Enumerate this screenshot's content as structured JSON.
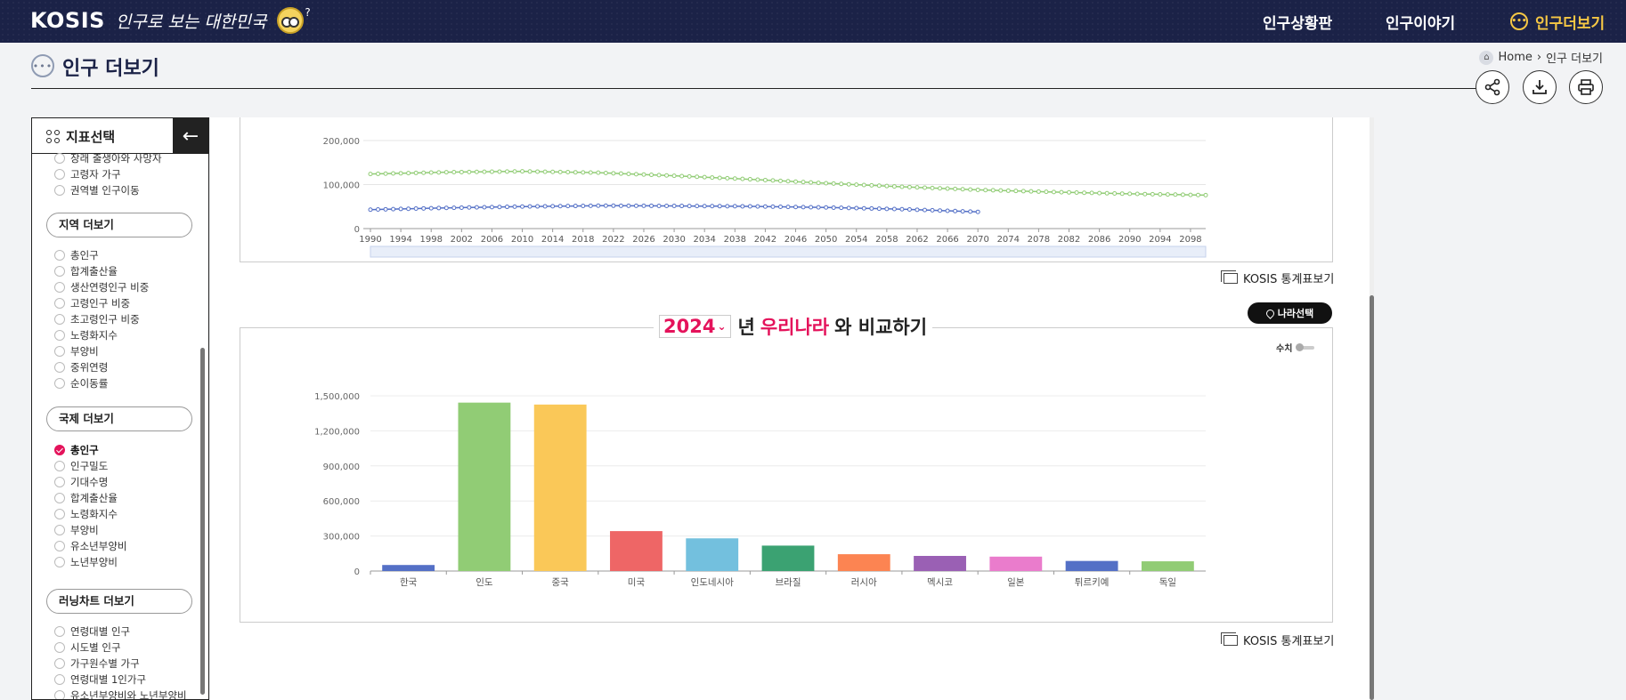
{
  "header": {
    "brand": "KOSIS",
    "slogan": "인구로 보는 대한민국",
    "mascot_mark": "?",
    "nav": [
      "인구상황판",
      "인구이야기",
      "인구더보기"
    ]
  },
  "page": {
    "title": "인구 더보기",
    "breadcrumb": {
      "home": "Home",
      "sep": "›",
      "current": "인구 더보기"
    }
  },
  "toolbar": {
    "icons": [
      "share-icon",
      "download-icon",
      "print-icon"
    ]
  },
  "sidebar": {
    "title": "지표선택",
    "top_items": [
      "장래 출생아와 사망자",
      "고령자 가구",
      "권역별 인구이동"
    ],
    "groups": [
      {
        "label": "지역 더보기",
        "items": [
          "총인구",
          "합계출산율",
          "생산연령인구 비중",
          "고령인구 비중",
          "초고령인구 비중",
          "노령화지수",
          "부양비",
          "중위연령",
          "순이동률"
        ]
      },
      {
        "label": "국제 더보기",
        "items": [
          "총인구",
          "인구밀도",
          "기대수명",
          "합계출산율",
          "노령화지수",
          "부양비",
          "유소년부양비",
          "노년부양비"
        ],
        "selected": 0
      },
      {
        "label": "러닝차트 더보기",
        "items": [
          "연령대별 인구",
          "시도별 인구",
          "가구원수별 가구",
          "연령대별 1인가구",
          "유소년부양비와 노년부양비"
        ]
      }
    ]
  },
  "kosis_link": "KOSIS 통계표보기",
  "compare": {
    "year": "2024",
    "year_suffix": "년",
    "country": "우리나라",
    "suffix": "와 비교하기",
    "country_button": "나라선택",
    "legend_toggle": "수치"
  },
  "colors": {
    "accent": "#e4135b",
    "header_bg": "#1b2247",
    "nav_highlight": "#f6c744"
  },
  "chart_data": [
    {
      "type": "line",
      "x_ticks": [
        1990,
        1994,
        1998,
        2002,
        2006,
        2010,
        2014,
        2018,
        2022,
        2026,
        2030,
        2034,
        2038,
        2042,
        2046,
        2050,
        2054,
        2058,
        2062,
        2066,
        2070,
        2074,
        2078,
        2082,
        2086,
        2090,
        2094,
        2098
      ],
      "y_ticks": [
        "0",
        "100,000",
        "200,000"
      ],
      "xlim": [
        1990,
        2100
      ],
      "ylim": [
        0,
        200000
      ],
      "series": [
        {
          "color": "#91cc75",
          "x_range": [
            1990,
            2100
          ],
          "points": [
            [
              1990,
              124000
            ],
            [
              2000,
              128000
            ],
            [
              2010,
              130000
            ],
            [
              2020,
              127000
            ],
            [
              2030,
              120000
            ],
            [
              2040,
              112000
            ],
            [
              2050,
              103000
            ],
            [
              2060,
              95000
            ],
            [
              2070,
              88000
            ],
            [
              2080,
              83000
            ],
            [
              2090,
              79000
            ],
            [
              2100,
              76000
            ]
          ]
        },
        {
          "color": "#5470c6",
          "x_range": [
            1990,
            2070
          ],
          "points": [
            [
              1990,
              43000
            ],
            [
              2000,
              47000
            ],
            [
              2010,
              50000
            ],
            [
              2020,
              52000
            ],
            [
              2030,
              51500
            ],
            [
              2040,
              50500
            ],
            [
              2050,
              48000
            ],
            [
              2060,
              44000
            ],
            [
              2070,
              38000
            ]
          ]
        }
      ]
    },
    {
      "type": "bar",
      "categories": [
        "한국",
        "인도",
        "중국",
        "미국",
        "인도네시아",
        "브라질",
        "러시아",
        "멕시코",
        "일본",
        "튀르키예",
        "독일"
      ],
      "values": [
        51700,
        1441700,
        1425200,
        341800,
        279800,
        217600,
        144000,
        129400,
        123300,
        86300,
        83300
      ],
      "colors": [
        "#5470c6",
        "#91cc75",
        "#fac858",
        "#ee6666",
        "#73c0de",
        "#3ba272",
        "#fc8452",
        "#9a60b4",
        "#ea7ccc",
        "#5470c6",
        "#91cc75"
      ],
      "y_ticks": [
        "0",
        "300,000",
        "600,000",
        "900,000",
        "1,200,000",
        "1,500,000"
      ],
      "ylim": [
        0,
        1500000
      ]
    }
  ]
}
